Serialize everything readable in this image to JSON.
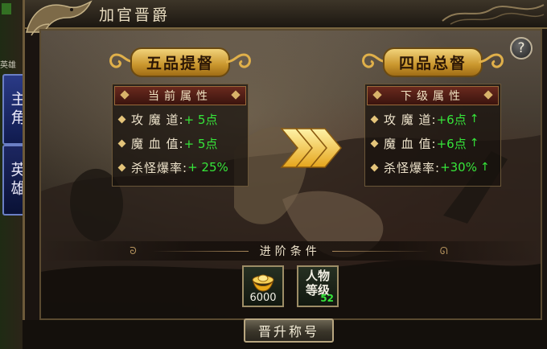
{
  "side_tabs": [
    {
      "label": "主角"
    },
    {
      "label": "英雄"
    }
  ],
  "left_strip_text": "英雄",
  "window": {
    "title": "加官晋爵"
  },
  "help": {
    "label": "?"
  },
  "current_rank": {
    "name": "五品提督"
  },
  "next_rank": {
    "name": "四品总督"
  },
  "current_attrs": {
    "header": "当前属性",
    "rows": [
      {
        "label": "攻 魔 道:",
        "value": "+ 5点"
      },
      {
        "label": "魔 血 值:",
        "value": "+ 5点"
      },
      {
        "label": "杀怪爆率:",
        "value": "+ 25%"
      }
    ]
  },
  "next_attrs": {
    "header": "下级属性",
    "rows": [
      {
        "label": "攻 魔 道:",
        "value": "+6点",
        "arrow": "↑"
      },
      {
        "label": "魔 血 值:",
        "value": "+6点",
        "arrow": "↑"
      },
      {
        "label": "杀怪爆率:",
        "value": "+30%",
        "arrow": "↑"
      }
    ]
  },
  "conditions": {
    "title": "进阶条件",
    "gold": {
      "value": "6000",
      "icon": "gold-ingot-icon"
    },
    "level": {
      "label_line1": "人物",
      "label_line2": "等级",
      "value": "52"
    }
  },
  "promote_button": {
    "label": "晋升称号"
  },
  "colors": {
    "accent_green": "#36e53a",
    "gold": "#e0b04a",
    "tab_blue": "#2a3a86"
  }
}
